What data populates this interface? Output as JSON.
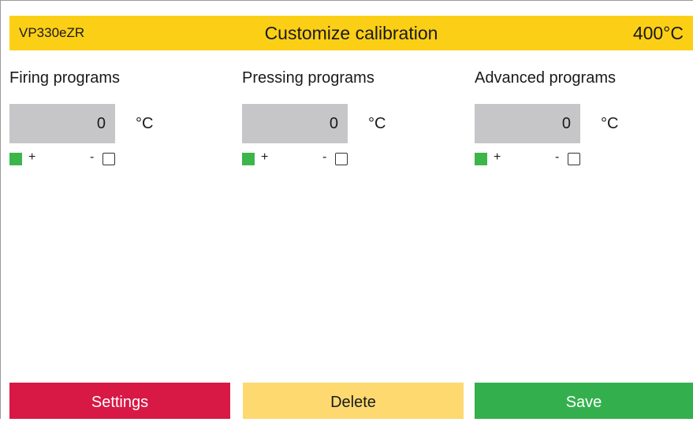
{
  "header": {
    "device": "VP330eZR",
    "title": "Customize calibration",
    "temperature": "400°C"
  },
  "columns": [
    {
      "label": "Firing programs",
      "value": "0",
      "unit": "°C",
      "plus": "+",
      "minus": "-"
    },
    {
      "label": "Pressing programs",
      "value": "0",
      "unit": "°C",
      "plus": "+",
      "minus": "-"
    },
    {
      "label": "Advanced programs",
      "value": "0",
      "unit": "°C",
      "plus": "+",
      "minus": "-"
    }
  ],
  "buttons": {
    "settings": "Settings",
    "delete": "Delete",
    "save": "Save"
  },
  "colors": {
    "header_bg": "#fccf17",
    "plus_green": "#3cb54a",
    "settings_red": "#d81845",
    "delete_yellow": "#fdd970",
    "save_green": "#33b04d",
    "value_box_gray": "#c6c6c8"
  }
}
